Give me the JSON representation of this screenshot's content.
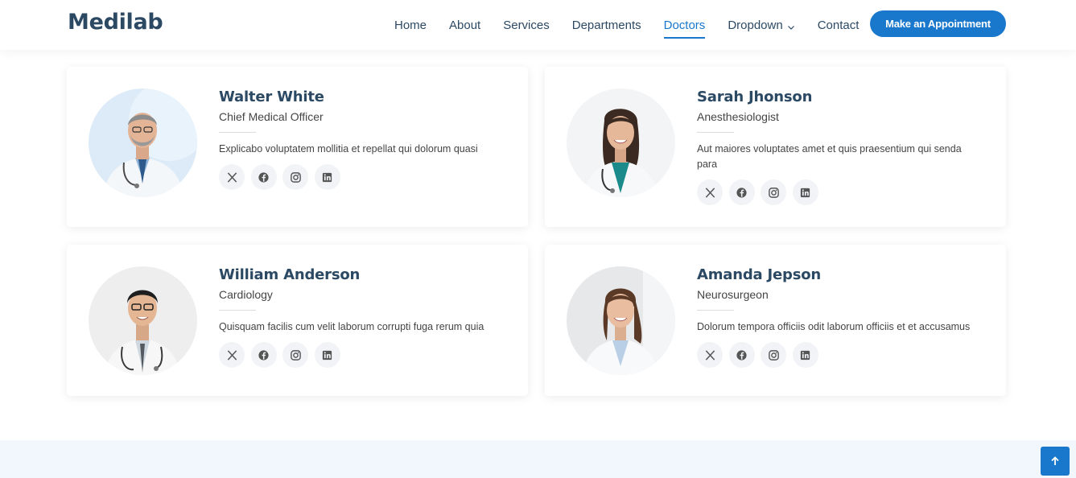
{
  "header": {
    "logo": "Medilab",
    "nav": [
      {
        "label": "Home",
        "active": false
      },
      {
        "label": "About",
        "active": false
      },
      {
        "label": "Services",
        "active": false
      },
      {
        "label": "Departments",
        "active": false
      },
      {
        "label": "Doctors",
        "active": true
      },
      {
        "label": "Dropdown",
        "active": false
      },
      {
        "label": "Contact",
        "active": false
      }
    ],
    "cta_label": "Make an Appointment"
  },
  "doctors": [
    {
      "name": "Walter White",
      "role": "Chief Medical Officer",
      "desc": "Explicabo voluptatem mollitia et repellat qui dolorum quasi"
    },
    {
      "name": "Sarah Jhonson",
      "role": "Anesthesiologist",
      "desc": "Aut maiores voluptates amet et quis praesentium qui senda para"
    },
    {
      "name": "William Anderson",
      "role": "Cardiology",
      "desc": "Quisquam facilis cum velit laborum corrupti fuga rerum quia"
    },
    {
      "name": "Amanda Jepson",
      "role": "Neurosurgeon",
      "desc": "Dolorum tempora officiis odit laborum officiis et et accusamus"
    }
  ],
  "icons": {
    "social": [
      "x-twitter-icon",
      "facebook-icon",
      "instagram-icon",
      "linkedin-icon"
    ],
    "dropdown": "chevron-down-icon",
    "back_to_top": "arrow-up-icon"
  },
  "colors": {
    "accent": "#1977cc",
    "heading": "#2c4964",
    "text": "#444444",
    "social_bg": "#f1f3f6",
    "footer_bg": "#f1f7fd"
  }
}
